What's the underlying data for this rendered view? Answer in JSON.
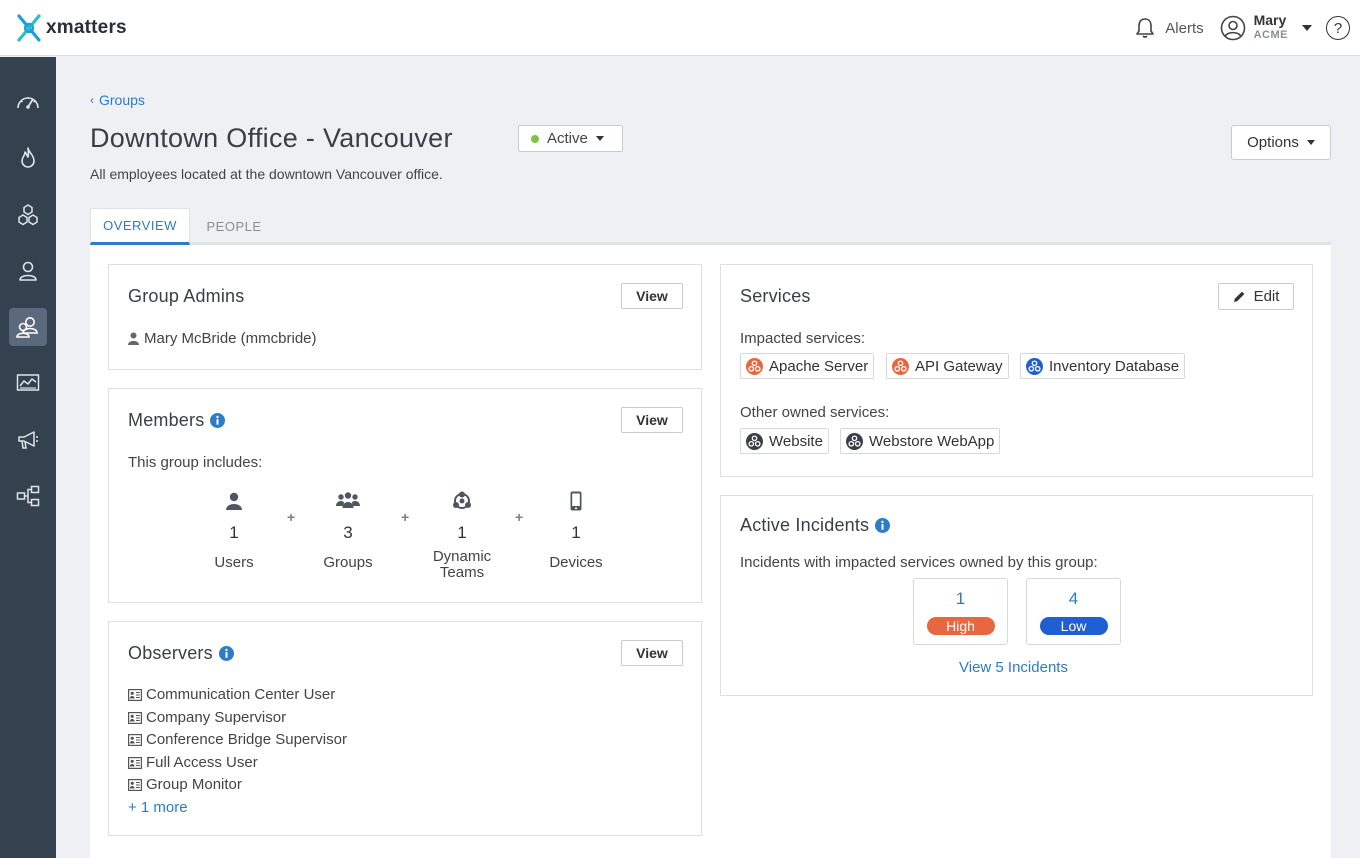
{
  "header": {
    "logo_text": "xmatters",
    "alerts_label": "Alerts",
    "user_name": "Mary",
    "user_org": "ACME",
    "help_label": "?"
  },
  "sidebar": {
    "items": [
      {
        "icon": "dashboard-icon"
      },
      {
        "icon": "flame-icon"
      },
      {
        "icon": "services-icon"
      },
      {
        "icon": "user-icon"
      },
      {
        "icon": "groups-icon",
        "active": true
      },
      {
        "icon": "reports-icon"
      },
      {
        "icon": "megaphone-icon"
      },
      {
        "icon": "workflows-icon"
      }
    ]
  },
  "page": {
    "breadcrumb": "Groups",
    "title": "Downtown Office - Vancouver",
    "status": "Active",
    "status_color": "#7cc243",
    "description": "All employees located at the downtown Vancouver office.",
    "options_label": "Options",
    "tabs": [
      {
        "label": "OVERVIEW",
        "active": true
      },
      {
        "label": "PEOPLE",
        "active": false
      }
    ]
  },
  "group_admins": {
    "title": "Group Admins",
    "view_label": "View",
    "admin": "Mary McBride (mmcbride)"
  },
  "members": {
    "title": "Members",
    "view_label": "View",
    "intro": "This group includes:",
    "items": [
      {
        "count": "1",
        "label": "Users",
        "icon": "user-icon"
      },
      {
        "count": "3",
        "label": "Groups",
        "icon": "groups-icon"
      },
      {
        "count": "1",
        "label": "Dynamic Teams",
        "icon": "dynamic-team-icon"
      },
      {
        "count": "1",
        "label": "Devices",
        "icon": "mobile-device-icon"
      }
    ],
    "plus": "+"
  },
  "observers": {
    "title": "Observers",
    "view_label": "View",
    "items": [
      "Communication Center User",
      "Company Supervisor",
      "Conference Bridge Supervisor",
      "Full Access User",
      "Group Monitor"
    ],
    "more": "+ 1 more"
  },
  "services": {
    "title": "Services",
    "edit_label": "Edit",
    "impacted_label": "Impacted services:",
    "impacted": [
      {
        "name": "Apache Server",
        "color": "#e8673f"
      },
      {
        "name": "API Gateway",
        "color": "#e8673f"
      },
      {
        "name": "Inventory Database",
        "color": "#1f5fd1"
      }
    ],
    "other_label": "Other owned services:",
    "other": [
      {
        "name": "Website",
        "color": "#3a3f45"
      },
      {
        "name": "Webstore WebApp",
        "color": "#3a3f45"
      }
    ]
  },
  "incidents": {
    "title": "Active Incidents",
    "intro": "Incidents with impacted services owned by this group:",
    "items": [
      {
        "count": "1",
        "severity": "High",
        "color": "#e8673f"
      },
      {
        "count": "4",
        "severity": "Low",
        "color": "#1f5fd1"
      }
    ],
    "view_link": "View 5 Incidents"
  }
}
